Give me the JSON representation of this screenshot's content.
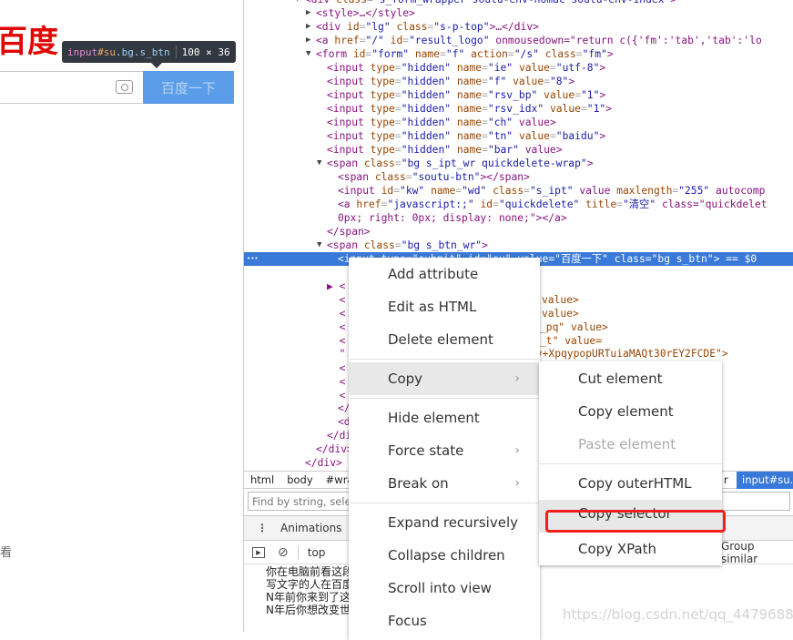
{
  "page": {
    "logo": "百度",
    "search_button": "百度一下",
    "tooltip_tag": "input",
    "tooltip_id": "#su",
    "tooltip_class": ".bg.s_btn",
    "tooltip_size": "100 × 36",
    "side_text": "看"
  },
  "code_lines": [
    [
      "▼",
      "<div class=\"s_form_wrapper soutu-env-nomac soutu-env-index\">"
    ],
    [
      "▶",
      "<style>…</style>"
    ],
    [
      "▶",
      "<div id=\"lg\" class=\"s-p-top\">…</div>"
    ],
    [
      "▶",
      "<a href=\"/\" id=\"result_logo\" onmousedown=\"return c({'fm':'tab','tab':'lo"
    ],
    [
      "▼",
      "<form id=\"form\" name=\"f\" action=\"/s\" class=\"fm\">"
    ],
    [
      "",
      "<input type=\"hidden\" name=\"ie\" value=\"utf-8\">"
    ],
    [
      "",
      "<input type=\"hidden\" name=\"f\" value=\"8\">"
    ],
    [
      "",
      "<input type=\"hidden\" name=\"rsv_bp\" value=\"1\">"
    ],
    [
      "",
      "<input type=\"hidden\" name=\"rsv_idx\" value=\"1\">"
    ],
    [
      "",
      "<input type=\"hidden\" name=\"ch\" value>"
    ],
    [
      "",
      "<input type=\"hidden\" name=\"tn\" value=\"baidu\">"
    ],
    [
      "",
      "<input type=\"hidden\" name=\"bar\" value>"
    ],
    [
      "▼",
      "<span class=\"bg s_ipt_wr quickdelete-wrap\">"
    ],
    [
      "",
      "<span class=\"soutu-btn\"></span>"
    ],
    [
      "",
      "<input id=\"kw\" name=\"wd\" class=\"s_ipt\" value maxlength=\"255\" autocomp"
    ],
    [
      "",
      "<a href=\"javascript:;\" id=\"quickdelete\" title=\"清空\" class=\"quickdelet"
    ],
    [
      "",
      "0px; right: 0px; display: none;\"></a>"
    ],
    [
      "",
      "</span>"
    ],
    [
      "▼",
      "<span class=\"bg s_btn_wr\">"
    ],
    [
      "",
      "<input type=\"submit\" id=\"su\" value=\"百度一下\" class=\"bg s_btn\"> == $0"
    ]
  ],
  "code_fragments": [
    "value>",
    "value>",
    "_pq\" value>",
    "_t\" value=",
    "pv+XpqypopURTuiaMAQt30rEY2FCDE\">",
    "</f",
    "<di",
    "</div>",
    "</div>",
    "</div>"
  ],
  "breadcrumbs": [
    "html",
    "body",
    "#wrap"
  ],
  "breadcrumb_partial": "r",
  "breadcrumb_current": "input#su.bg.s_btn",
  "find_placeholder": "Find by string, selector",
  "drawer_tab": "Animations",
  "console_context": "top",
  "group_similar": "Group similar",
  "console_lines": [
    "你在电脑前看这段",
    "写文字的人在百度",
    "N年前你来到了这",
    "N年后你想改变世"
  ],
  "context_menu": [
    "Add attribute",
    "Edit as HTML",
    "Delete element",
    "Copy",
    "Hide element",
    "Force state",
    "Break on",
    "Expand recursively",
    "Collapse children",
    "Scroll into view",
    "Focus"
  ],
  "copy_submenu": [
    "Cut element",
    "Copy element",
    "Paste element",
    "Copy outerHTML",
    "Copy selector",
    "Copy XPath"
  ],
  "watermark": "https://blog.csdn.net/qq_44796882",
  "colors": {
    "selection": "#3879d9",
    "highlight_box": "#f0201c",
    "baidu_red": "#e10602",
    "search_button": "#5b9de8"
  }
}
